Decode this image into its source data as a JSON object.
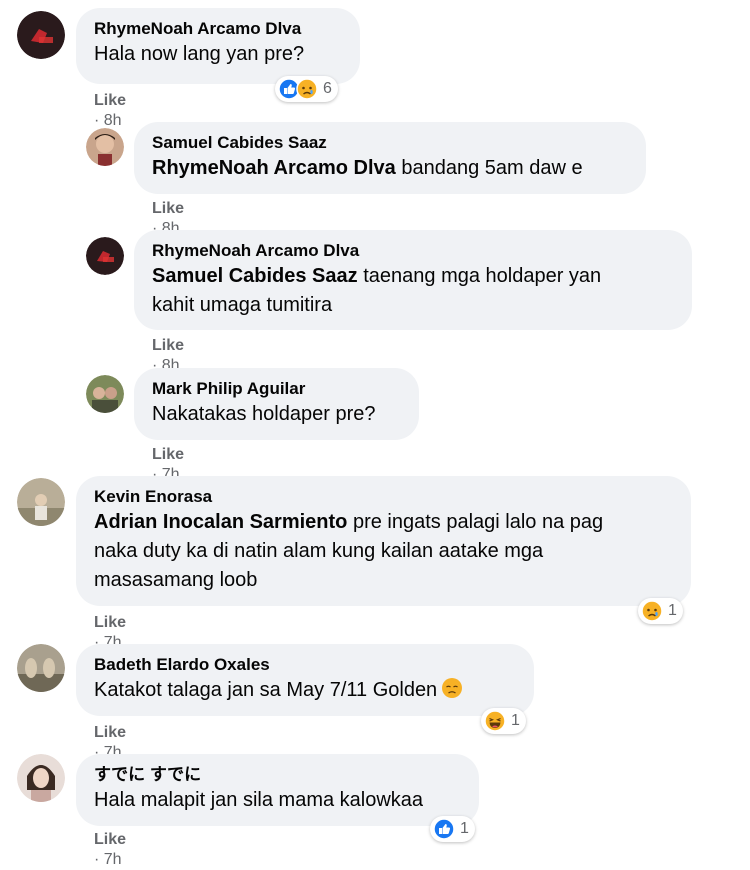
{
  "comments": [
    {
      "author": "RhymeNoah Arcamo Dlva",
      "text": "Hala now lang yan pre?",
      "like": "Like",
      "time": "8h",
      "reactions": {
        "types": [
          "like-icon",
          "sad-icon"
        ],
        "count": "6"
      }
    },
    {
      "author": "Samuel Cabides Saaz",
      "mention": "RhymeNoah Arcamo Dlva",
      "text": " bandang 5am daw e",
      "like": "Like",
      "time": "8h"
    },
    {
      "author": "RhymeNoah Arcamo Dlva",
      "mention": "Samuel Cabides Saaz",
      "text_line1": " taenang mga holdaper yan",
      "text_line2": "kahit umaga tumitira",
      "like": "Like",
      "time": "8h"
    },
    {
      "author": "Mark Philip Aguilar",
      "text": "Nakatakas holdaper pre?",
      "like": "Like",
      "time": "7h"
    },
    {
      "author": "Kevin Enorasa",
      "mention": "Adrian Inocalan Sarmiento",
      "text_line1": " pre ingats palagi lalo na pag",
      "text_line2": "naka duty ka di natin alam kung kailan aatake mga",
      "text_line3": "masasamang loob",
      "like": "Like",
      "time": "7h",
      "reactions": {
        "types": [
          "sad-icon"
        ],
        "count": "1"
      }
    },
    {
      "author": "Badeth Elardo Oxales",
      "text": "Katakot talaga jan sa May 7/11 Golden",
      "like": "Like",
      "time": "7h",
      "reactions": {
        "types": [
          "haha-icon"
        ],
        "count": "1"
      }
    },
    {
      "author": "すでに すでに",
      "text": "Hala malapit jan sila mama kalowkaa",
      "like": "Like",
      "time": "7h",
      "reactions": {
        "types": [
          "like-icon"
        ],
        "count": "1"
      }
    }
  ],
  "meta_separator": "·",
  "colors": {
    "bubble": "#f0f2f5",
    "meta_text": "#65676b",
    "like_blue": "#1877f2",
    "emoji_yellow": "#f7b125"
  }
}
